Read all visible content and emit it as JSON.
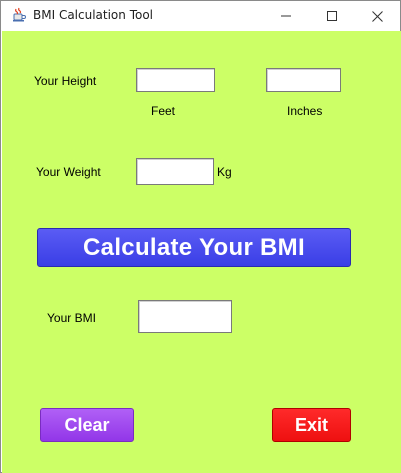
{
  "window": {
    "title": "BMI Calculation Tool",
    "app_icon": "java-cup-icon"
  },
  "form": {
    "height_label": "Your Height",
    "height_feet_value": "",
    "height_inches_value": "",
    "feet_label": "Feet",
    "inches_label": "Inches",
    "weight_label": "Your Weight",
    "weight_value": "",
    "weight_unit": "Kg",
    "bmi_label": "Your BMI",
    "bmi_value": ""
  },
  "buttons": {
    "calculate_label": "Calculate Your BMI",
    "clear_label": "Clear",
    "exit_label": "Exit"
  },
  "colors": {
    "background": "#ccff66",
    "calculate_button": "#4a4cf0",
    "clear_button": "#a04ef0",
    "exit_button": "#ff1a1a"
  }
}
